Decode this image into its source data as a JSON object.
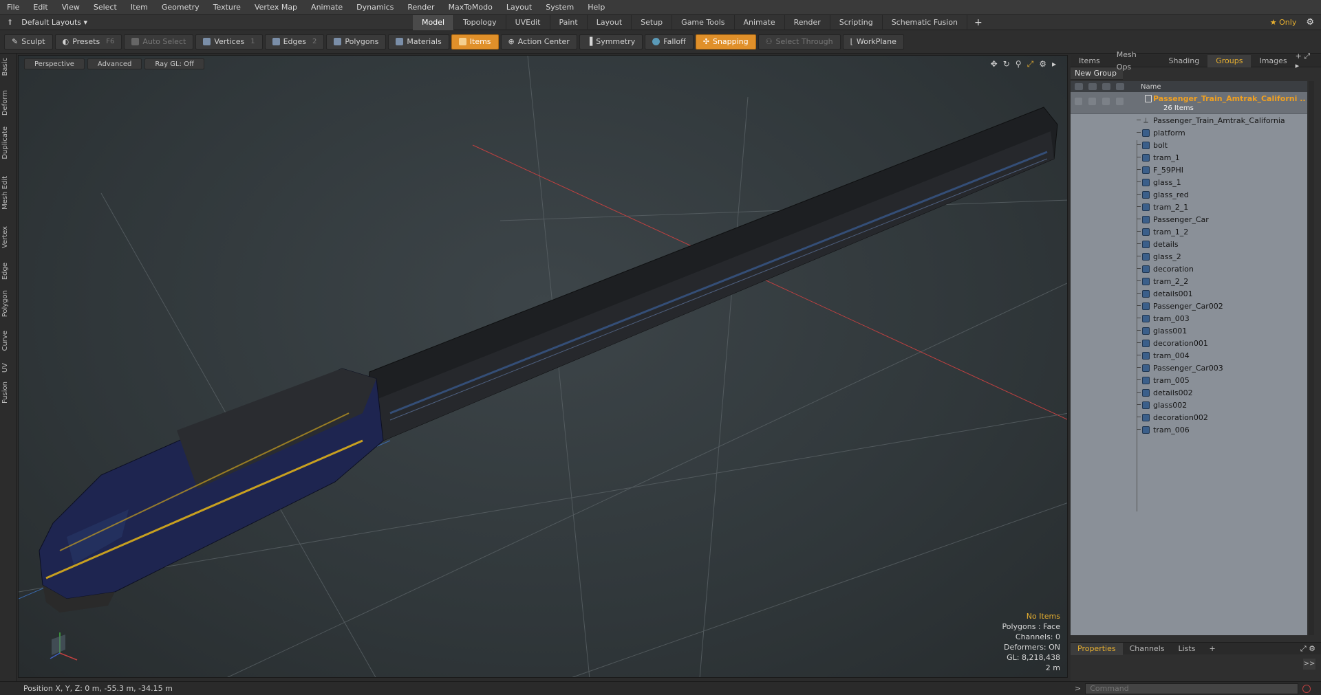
{
  "menu": [
    "File",
    "Edit",
    "View",
    "Select",
    "Item",
    "Geometry",
    "Texture",
    "Vertex Map",
    "Animate",
    "Dynamics",
    "Render",
    "MaxToModo",
    "Layout",
    "System",
    "Help"
  ],
  "layout": {
    "name": "Default Layouts ▾"
  },
  "tabs": [
    "Model",
    "Topology",
    "UVEdit",
    "Paint",
    "Layout",
    "Setup",
    "Game Tools",
    "Animate",
    "Render",
    "Scripting",
    "Schematic Fusion"
  ],
  "tabs_active": "Model",
  "tab_add": "+",
  "only_label": "★ Only",
  "toolbar": {
    "sculpt": "Sculpt",
    "presets": "Presets",
    "presets_key": "F6",
    "auto_select": "Auto Select",
    "vertices": "Vertices",
    "vertices_key": "1",
    "edges": "Edges",
    "edges_key": "2",
    "polygons": "Polygons",
    "materials": "Materials",
    "items": "Items",
    "action_center": "Action Center",
    "symmetry": "Symmetry",
    "falloff": "Falloff",
    "snapping": "Snapping",
    "select_through": "Select Through",
    "workplane": "WorkPlane"
  },
  "left_tabs": [
    "Basic",
    "Deform",
    "Duplicate",
    "Mesh Edit",
    "Vertex",
    "Edge",
    "Polygon",
    "Curve",
    "UV",
    "Fusion"
  ],
  "viewport": {
    "perspective": "Perspective",
    "advanced": "Advanced",
    "raygl": "Ray GL: Off",
    "info": {
      "no_items": "No Items",
      "polygons": "Polygons : Face",
      "channels": "Channels: 0",
      "deformers": "Deformers: ON",
      "gl": "GL: 8,218,438",
      "scale": "2 m"
    }
  },
  "right_panel": {
    "tabs": [
      "Items",
      "Mesh Ops",
      "Shading",
      "Groups",
      "Images"
    ],
    "active_tab": "Groups",
    "new_group": "New Group",
    "col_name": "Name",
    "group_name": "Passenger_Train_Amtrak_Californi ...",
    "group_count": "26 Items",
    "items": [
      "Passenger_Train_Amtrak_California",
      "platform",
      "bolt",
      "tram_1",
      "F_59PHI",
      "glass_1",
      "glass_red",
      "tram_2_1",
      "Passenger_Car",
      "tram_1_2",
      "details",
      "glass_2",
      "decoration",
      "tram_2_2",
      "details001",
      "Passenger_Car002",
      "tram_003",
      "glass001",
      "decoration001",
      "tram_004",
      "Passenger_Car003",
      "tram_005",
      "details002",
      "glass002",
      "decoration002",
      "tram_006"
    ]
  },
  "bottom_tabs": [
    "Properties",
    "Channels",
    "Lists"
  ],
  "bottom_active": "Properties",
  "status": "Position X, Y, Z:  0 m, -55.3 m, -34.15 m",
  "command_placeholder": "Command",
  "colors": {
    "accent": "#e8b030",
    "active_tool": "#e0902a",
    "tree_bg": "#8a9098"
  }
}
